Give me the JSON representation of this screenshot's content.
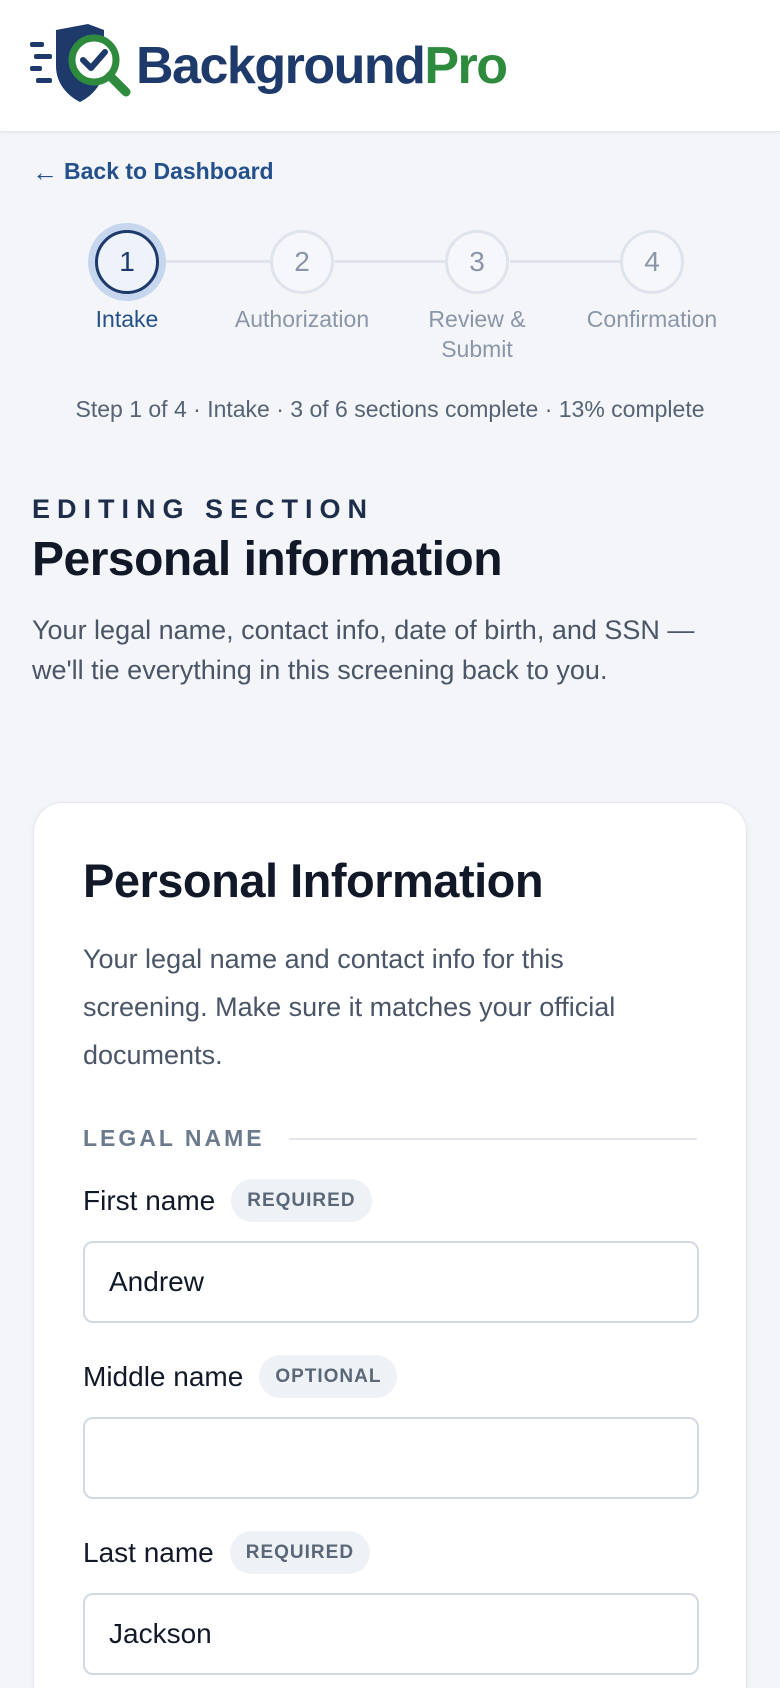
{
  "brand": {
    "name_part1": "Background",
    "name_part2": "Pro",
    "color_primary": "#1e3a6a",
    "color_accent": "#2e8b3e"
  },
  "nav": {
    "back_arrow": "←",
    "back_label": "Back to Dashboard"
  },
  "stepper": {
    "steps": [
      {
        "number": "1",
        "label": "Intake",
        "state": "active"
      },
      {
        "number": "2",
        "label": "Authorization",
        "state": "upcoming"
      },
      {
        "number": "3",
        "label": "Review & Submit",
        "state": "upcoming"
      },
      {
        "number": "4",
        "label": "Confirmation",
        "state": "upcoming"
      }
    ],
    "progress_text": "Step 1 of 4 · Intake · 3 of 6 sections complete · 13% complete"
  },
  "section": {
    "eyebrow": "EDITING SECTION",
    "title": "Personal information",
    "description": "Your legal name, contact info, date of birth, and SSN — we'll tie everything in this screening back to you."
  },
  "card": {
    "title": "Personal Information",
    "description": "Your legal name and contact info for this screening. Make sure it matches your official documents.",
    "group_label": "LEGAL NAME",
    "fields": {
      "first_name": {
        "label": "First name",
        "badge": "REQUIRED",
        "value": "Andrew"
      },
      "middle_name": {
        "label": "Middle name",
        "badge": "OPTIONAL",
        "value": ""
      },
      "last_name": {
        "label": "Last name",
        "badge": "REQUIRED",
        "value": "Jackson"
      }
    }
  }
}
